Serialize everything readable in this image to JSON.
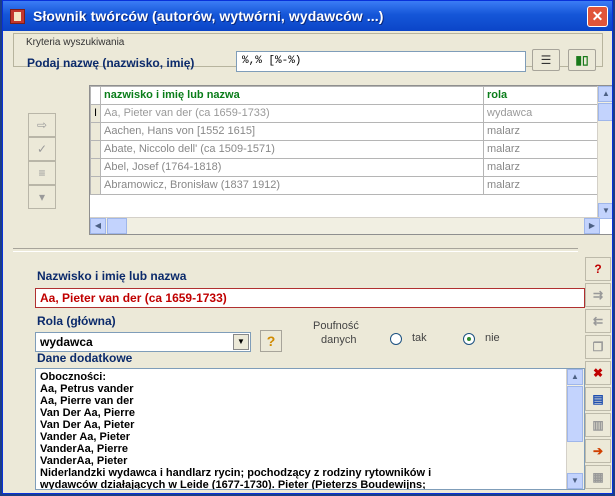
{
  "window": {
    "title": "Słownik twórców (autorów, wytwórni, wydawców ...)",
    "close_glyph": "✕"
  },
  "search": {
    "group_label": "Kryteria wyszukiwania",
    "label": "Podaj nazwę (nazwisko, imię)",
    "value": "%,% [%-%)",
    "filter_icon": "filter-list-icon",
    "chart_icon": "bar-chart-icon"
  },
  "grid": {
    "columns": [
      "nazwisko i imię lub nazwa",
      "rola"
    ],
    "rows": [
      {
        "name": "Aa, Pieter van der (ca 1659-1733)",
        "role": "wydawca",
        "indicator": "I"
      },
      {
        "name": "Aachen, Hans von [1552 1615]",
        "role": "malarz",
        "indicator": ""
      },
      {
        "name": "Abate, Niccolo dell' (ca 1509-1571)",
        "role": "malarz",
        "indicator": ""
      },
      {
        "name": "Abel, Josef (1764-1818)",
        "role": "malarz",
        "indicator": ""
      },
      {
        "name": "Abramowicz, Bronisław (1837 1912)",
        "role": "malarz",
        "indicator": ""
      }
    ]
  },
  "side_buttons": [
    {
      "icon": "select-icon",
      "glyph": "⇨"
    },
    {
      "icon": "checkmark-icon",
      "glyph": "✓"
    },
    {
      "icon": "insert-icon",
      "glyph": "≡"
    },
    {
      "icon": "down-icon",
      "glyph": "▾"
    }
  ],
  "detail": {
    "name_label": "Nazwisko i imię lub nazwa",
    "name_value": "Aa, Pieter van der (ca 1659-1733)",
    "role_label": "Rola (główna)",
    "role_value": "wydawca",
    "help_glyph": "?",
    "privacy_label_1": "Poufność",
    "privacy_label_2": "danych",
    "radio_yes": "tak",
    "radio_no": "nie",
    "radio_selected": "nie",
    "extra_label": "Dane dodatkowe",
    "extra_lines": [
      "Oboczności:",
      "Aa, Petrus vander",
      "Aa, Pierre van der",
      "Van Der Aa, Pierre",
      "Van Der Aa, Pieter",
      "Vander Aa, Pieter",
      "VanderAa, Pierre",
      "VanderAa, Pieter",
      "",
      "Niderlandzki wydawca i handlarz rycin; pochodzący z rodziny rytowników i",
      "wydawców działających w Leide (1677-1730). Pieter (Pieterzs Boudewijns;"
    ]
  },
  "right_toolbar": [
    {
      "icon": "search-person-icon",
      "glyph": "?",
      "color": "#c00000"
    },
    {
      "icon": "arrange-icon",
      "glyph": "⇉",
      "color": "#999999"
    },
    {
      "icon": "split-icon",
      "glyph": "⇇",
      "color": "#999999"
    },
    {
      "icon": "copy-icon",
      "glyph": "❐",
      "color": "#999999"
    },
    {
      "icon": "delete-icon",
      "glyph": "✖",
      "color": "#c00000"
    },
    {
      "icon": "edit-record-icon",
      "glyph": "▤",
      "color": "#1f4fb0"
    },
    {
      "icon": "paste-icon",
      "glyph": "▥",
      "color": "#999999"
    },
    {
      "icon": "goto-icon",
      "glyph": "➔",
      "color": "#d04000"
    },
    {
      "icon": "calculator-icon",
      "glyph": "▦",
      "color": "#999999"
    },
    {
      "icon": "exit-door-icon",
      "glyph": "⛶",
      "color": "#7a5a00"
    }
  ]
}
